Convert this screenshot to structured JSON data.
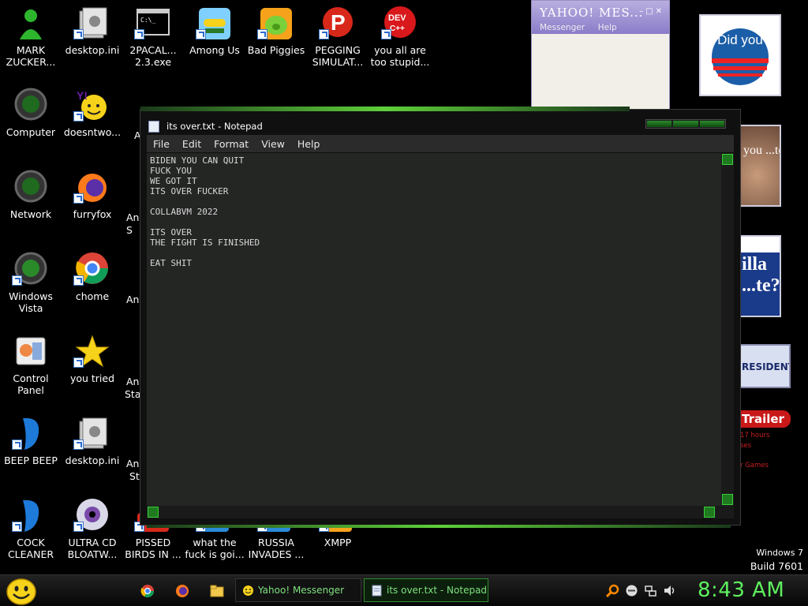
{
  "desktop_icons": [
    {
      "label": "MARK ZUCKER...",
      "icon": "green-figure-icon"
    },
    {
      "label": "desktop.ini",
      "icon": "settings-file-icon"
    },
    {
      "label": "2PACAL... 2.3.exe",
      "icon": "console-icon"
    },
    {
      "label": "Among Us",
      "icon": "among-us-icon"
    },
    {
      "label": "Bad Piggies",
      "icon": "bad-piggies-icon"
    },
    {
      "label": "PEGGING SIMULAT...",
      "icon": "pegging-icon"
    },
    {
      "label": "you all are too stupid...",
      "icon": "devcpp-icon"
    },
    {
      "label": "Computer",
      "icon": "computer-icon"
    },
    {
      "label": "doesntwo...",
      "icon": "yahoo-icon"
    },
    {
      "label": "Network",
      "icon": "network-icon"
    },
    {
      "label": "furryfox",
      "icon": "firefox-icon"
    },
    {
      "label": "Windows Vista",
      "icon": "recycle-icon"
    },
    {
      "label": "chome",
      "icon": "chrome-icon"
    },
    {
      "label": "Control Panel",
      "icon": "control-panel-icon"
    },
    {
      "label": "you tried",
      "icon": "star-icon"
    },
    {
      "label": "BEEP BEEP",
      "icon": "blue-shape-icon"
    },
    {
      "label": "desktop.ini",
      "icon": "settings-file-icon"
    },
    {
      "label": "COCK CLEANER",
      "icon": "blue-shape-icon"
    },
    {
      "label": "ULTRA CD BLOATW...",
      "icon": "cd-icon"
    },
    {
      "label": "PISSED BIRDS IN ...",
      "icon": "angry-birds-icon"
    },
    {
      "label": "what the fuck is goi...",
      "icon": "app-icon"
    },
    {
      "label": "RUSSIA INVADES ...",
      "icon": "app-icon"
    },
    {
      "label": "XMPP",
      "icon": "xmpp-icon"
    }
  ],
  "partial_labels": [
    "A",
    "An",
    "S",
    "An",
    "An",
    "Sta",
    "An",
    "St"
  ],
  "yahoo_window": {
    "brand": "YAHOO! MES...",
    "menu_items": [
      "Messenger",
      "Help"
    ]
  },
  "banners": {
    "obama_top": "Did you",
    "banner2_text": "you ...te?",
    "banner3_text": "illa ...te?",
    "banner4_text": "RESIDENT",
    "banner5_title": "Trailer",
    "banner5_lines": [
      "17 hours",
      "ses",
      "r Games"
    ]
  },
  "notepad": {
    "title": "its over.txt - Notepad",
    "menu": [
      "File",
      "Edit",
      "Format",
      "View",
      "Help"
    ],
    "content": "BIDEN YOU CAN QUIT\nFUCK YOU\nWE GOT IT\nITS OVER FUCKER\n\nCOLLABVM 2022\n\nITS OVER\nTHE FIGHT IS FINISHED\n\nEAT SHIT"
  },
  "watermark": {
    "os": "Windows 7",
    "build": "Build 7601"
  },
  "taskbar": {
    "buttons": [
      {
        "label": "Yahoo! Messenger"
      },
      {
        "label": "its over.txt - Notepad"
      }
    ],
    "clock": "8:43 AM"
  },
  "colors": {
    "accent_green": "#5ef05e",
    "desktop_bg": "#000000",
    "notepad_bg": "#242624"
  }
}
